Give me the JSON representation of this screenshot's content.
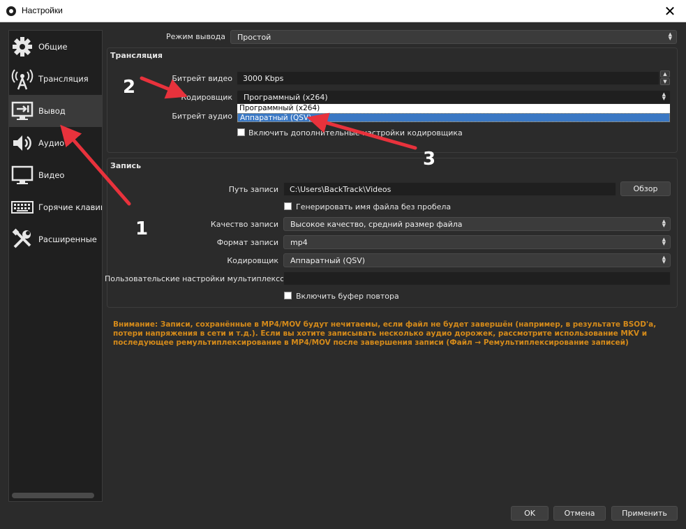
{
  "window": {
    "title": "Настройки",
    "close_glyph": "✕"
  },
  "sidebar": {
    "items": [
      {
        "label": "Общие",
        "icon": "gear-icon",
        "active": false
      },
      {
        "label": "Трансляция",
        "icon": "broadcast-antenna-icon",
        "active": false
      },
      {
        "label": "Вывод",
        "icon": "output-monitor-icon",
        "active": true
      },
      {
        "label": "Аудио",
        "icon": "speaker-icon",
        "active": false
      },
      {
        "label": "Видео",
        "icon": "monitor-icon",
        "active": false
      },
      {
        "label": "Горячие клавиш",
        "icon": "keyboard-icon",
        "active": false
      },
      {
        "label": "Расширенные",
        "icon": "tools-icon",
        "active": false
      }
    ]
  },
  "output_mode": {
    "label": "Режим вывода",
    "value": "Простой"
  },
  "streaming": {
    "title": "Трансляция",
    "video_bitrate": {
      "label": "Битрейт видео",
      "value": "3000 Kbps"
    },
    "encoder": {
      "label": "Кодировщик",
      "value": "Программный (x264)",
      "options": [
        "Программный (x264)",
        "Аппаратный (QSV)"
      ],
      "highlighted_option": "Аппаратный (QSV)"
    },
    "audio_bitrate": {
      "label": "Битрейт аудио"
    },
    "advanced_encoder_checkbox": {
      "label": "Включить дополнительные настройки кодировщика",
      "checked": false
    }
  },
  "recording": {
    "title": "Запись",
    "path": {
      "label": "Путь записи",
      "value": "C:\\Users\\BackTrack\\Videos",
      "browse_label": "Обзор"
    },
    "no_space_checkbox": {
      "label": "Генерировать имя файла без пробела",
      "checked": false
    },
    "quality": {
      "label": "Качество записи",
      "value": "Высокое качество, средний размер файла"
    },
    "format": {
      "label": "Формат записи",
      "value": "mp4"
    },
    "encoder": {
      "label": "Кодировщик",
      "value": "Аппаратный (QSV)"
    },
    "muxer": {
      "label": "Пользовательские настройки мультиплексора",
      "value": ""
    },
    "replay_buffer_checkbox": {
      "label": "Включить буфер повтора",
      "checked": false
    }
  },
  "warning_text": "Внимание: Записи, сохранённые в MP4/MOV будут нечитаемы, если файл не будет завершён (например, в результате BSOD'а, потери напряжения в сети и т.д.). Если вы хотите записывать несколько аудио дорожек, рассмотрите использование MKV и последующее ремультиплексирование в MP4/MOV после завершения записи (Файл → Ремультиплексирование записей)",
  "footer": {
    "ok": "OK",
    "cancel": "Отмена",
    "apply": "Применить"
  },
  "annotations": {
    "marker_1": "1",
    "marker_2": "2",
    "marker_3": "3",
    "arrow_color": "#e8323c"
  },
  "colors": {
    "warning": "#d48a1a",
    "selection": "#3a78c4",
    "background": "#2b2b2b"
  }
}
